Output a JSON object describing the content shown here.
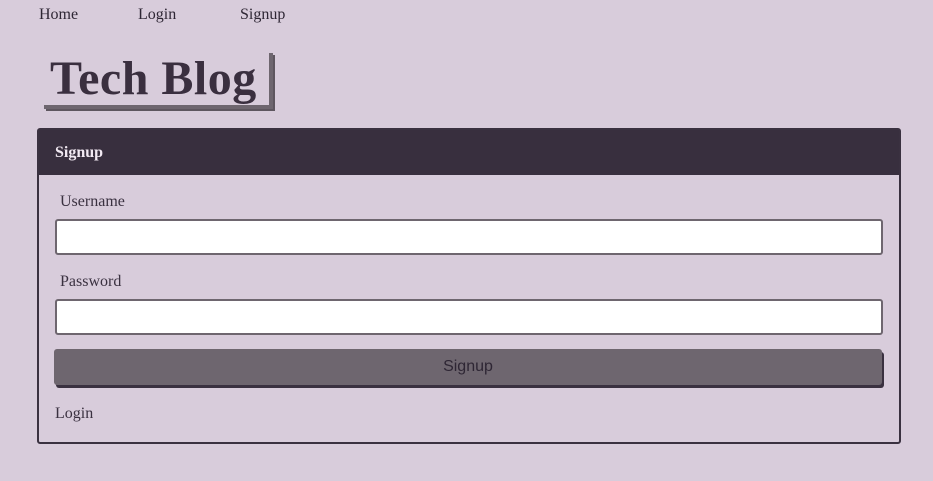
{
  "nav": {
    "home": "Home",
    "login": "Login",
    "signup": "Signup"
  },
  "logo": {
    "title": "Tech Blog"
  },
  "card": {
    "title": "Signup",
    "username_label": "Username",
    "username_value": "",
    "password_label": "Password",
    "password_value": "",
    "submit_label": "Signup",
    "login_link": "Login"
  },
  "colors": {
    "background": "#d8ccdb",
    "header_bg": "#382f3e",
    "button_bg": "#6e666f",
    "text": "#3a3140"
  }
}
